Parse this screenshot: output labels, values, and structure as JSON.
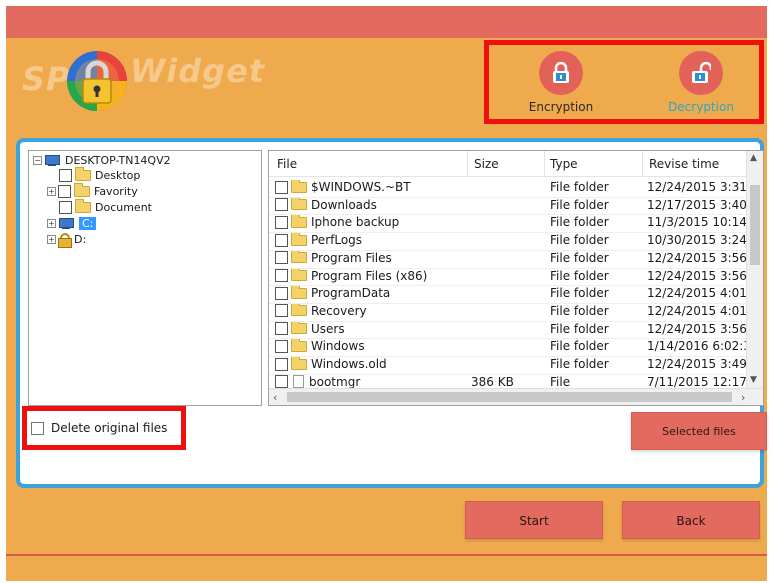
{
  "app": {
    "logo_left": "SP",
    "logo_right": "Widget"
  },
  "modes": {
    "encryption_label": "Encryption",
    "decryption_label": "Decryption",
    "accent": "#e2625a",
    "active_text_color": "#2aa7c9"
  },
  "tree": {
    "root": "DESKTOP-TN14QV2",
    "children": [
      "Desktop",
      "Favority",
      "Document"
    ],
    "drives": [
      "C:",
      "D:"
    ]
  },
  "table": {
    "headers": [
      "File",
      "Size",
      "Type",
      "Revise time"
    ],
    "rows": [
      {
        "name": "$WINDOWS.~BT",
        "size": "",
        "type": "File folder",
        "time": "12/24/2015 3:31"
      },
      {
        "name": "Downloads",
        "size": "",
        "type": "File folder",
        "time": "12/17/2015 3:40"
      },
      {
        "name": "Iphone backup",
        "size": "",
        "type": "File folder",
        "time": "11/3/2015 10:14"
      },
      {
        "name": "PerfLogs",
        "size": "",
        "type": "File folder",
        "time": "10/30/2015 3:24"
      },
      {
        "name": "Program Files",
        "size": "",
        "type": "File folder",
        "time": "12/24/2015 3:56"
      },
      {
        "name": "Program Files (x86)",
        "size": "",
        "type": "File folder",
        "time": "12/24/2015 3:56"
      },
      {
        "name": "ProgramData",
        "size": "",
        "type": "File folder",
        "time": "12/24/2015 4:01"
      },
      {
        "name": "Recovery",
        "size": "",
        "type": "File folder",
        "time": "12/24/2015 4:01"
      },
      {
        "name": "Users",
        "size": "",
        "type": "File folder",
        "time": "12/24/2015 3:56"
      },
      {
        "name": "Windows",
        "size": "",
        "type": "File folder",
        "time": "1/14/2016 6:02:3"
      },
      {
        "name": "Windows.old",
        "size": "",
        "type": "File folder",
        "time": "12/24/2015 3:49"
      },
      {
        "name": "bootmgr",
        "size": "386 KB",
        "type": "File",
        "time": "7/11/2015 12:17"
      }
    ]
  },
  "options": {
    "delete_original_label": "Delete original files"
  },
  "buttons": {
    "selected_files": "Selected files",
    "start": "Start",
    "back": "Back"
  },
  "colors": {
    "header_bg": "#f0aa4e",
    "title_strip": "#e26a5e",
    "panel_border": "#3aa3e0",
    "highlight_box": "#ee0f0f"
  }
}
